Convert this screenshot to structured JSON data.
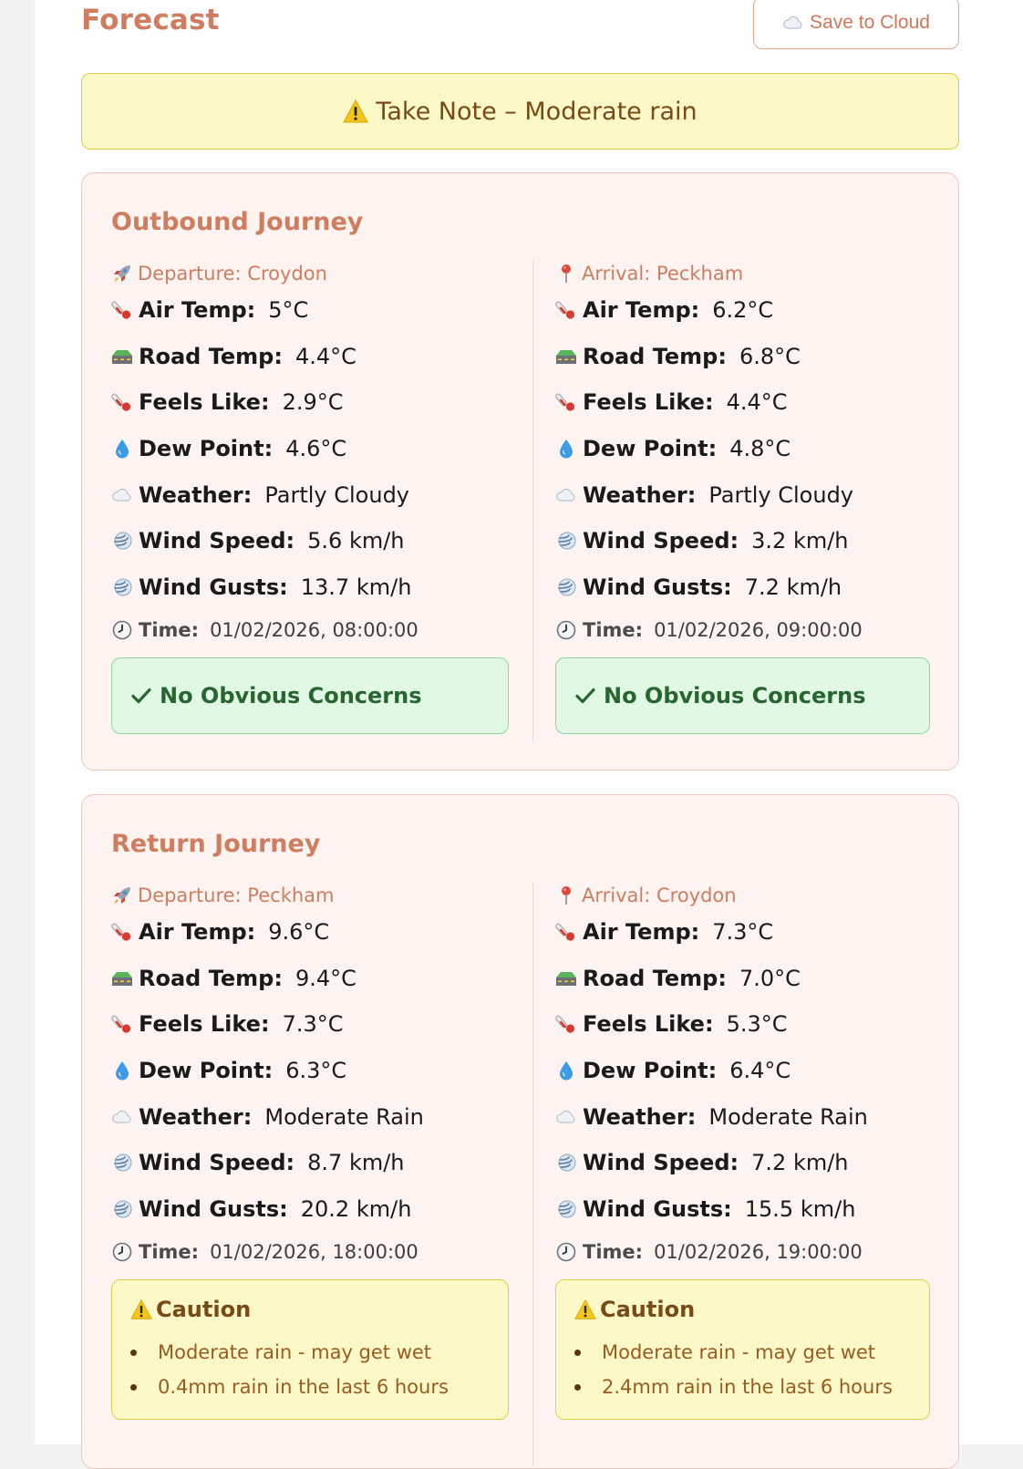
{
  "header": {
    "title": "Forecast",
    "save_label": "Save to Cloud",
    "save_icon": "cloud-icon"
  },
  "banner": {
    "icon": "warning-icon",
    "text": "Take Note – Moderate rain"
  },
  "journeys": [
    {
      "title": "Outbound Journey",
      "departure": {
        "heading": "Departure: Croydon",
        "air_temp_label": "Air Temp",
        "air_temp": "5°C",
        "road_temp_label": "Road Temp",
        "road_temp": "4.4°C",
        "feels_like_label": "Feels Like",
        "feels_like": "2.9°C",
        "dew_point_label": "Dew Point",
        "dew_point": "4.6°C",
        "weather_label": "Weather",
        "weather": "Partly Cloudy",
        "wind_speed_label": "Wind Speed",
        "wind_speed": "5.6 km/h",
        "wind_gusts_label": "Wind Gusts",
        "wind_gusts": "13.7 km/h",
        "time_label": "Time",
        "time": "01/02/2026, 08:00:00",
        "status": "No Obvious Concerns"
      },
      "arrival": {
        "heading": "Arrival: Peckham",
        "air_temp_label": "Air Temp",
        "air_temp": "6.2°C",
        "road_temp_label": "Road Temp",
        "road_temp": "6.8°C",
        "feels_like_label": "Feels Like",
        "feels_like": "4.4°C",
        "dew_point_label": "Dew Point",
        "dew_point": "4.8°C",
        "weather_label": "Weather",
        "weather": "Partly Cloudy",
        "wind_speed_label": "Wind Speed",
        "wind_speed": "3.2 km/h",
        "wind_gusts_label": "Wind Gusts",
        "wind_gusts": "7.2 km/h",
        "time_label": "Time",
        "time": "01/02/2026, 09:00:00",
        "status": "No Obvious Concerns"
      }
    },
    {
      "title": "Return Journey",
      "departure": {
        "heading": "Departure: Peckham",
        "air_temp_label": "Air Temp",
        "air_temp": "9.6°C",
        "road_temp_label": "Road Temp",
        "road_temp": "9.4°C",
        "feels_like_label": "Feels Like",
        "feels_like": "7.3°C",
        "dew_point_label": "Dew Point",
        "dew_point": "6.3°C",
        "weather_label": "Weather",
        "weather": "Moderate Rain",
        "wind_speed_label": "Wind Speed",
        "wind_speed": "8.7 km/h",
        "wind_gusts_label": "Wind Gusts",
        "wind_gusts": "20.2 km/h",
        "time_label": "Time",
        "time": "01/02/2026, 18:00:00",
        "caution_title": "Caution",
        "caution_items": [
          "Moderate rain - may get wet",
          "0.4mm rain in the last 6 hours"
        ]
      },
      "arrival": {
        "heading": "Arrival: Croydon",
        "air_temp_label": "Air Temp",
        "air_temp": "7.3°C",
        "road_temp_label": "Road Temp",
        "road_temp": "7.0°C",
        "feels_like_label": "Feels Like",
        "feels_like": "5.3°C",
        "dew_point_label": "Dew Point",
        "dew_point": "6.4°C",
        "weather_label": "Weather",
        "weather": "Moderate Rain",
        "wind_speed_label": "Wind Speed",
        "wind_speed": "7.2 km/h",
        "wind_gusts_label": "Wind Gusts",
        "wind_gusts": "15.5 km/h",
        "time_label": "Time",
        "time": "01/02/2026, 19:00:00",
        "caution_title": "Caution",
        "caution_items": [
          "Moderate rain - may get wet",
          "2.4mm rain in the last 6 hours"
        ]
      }
    }
  ],
  "colors": {
    "accent": "#cf7d5e",
    "warning_bg": "#fdf8c7",
    "success_bg": "#e1f8e5",
    "card_bg": "#fdf4f2"
  }
}
